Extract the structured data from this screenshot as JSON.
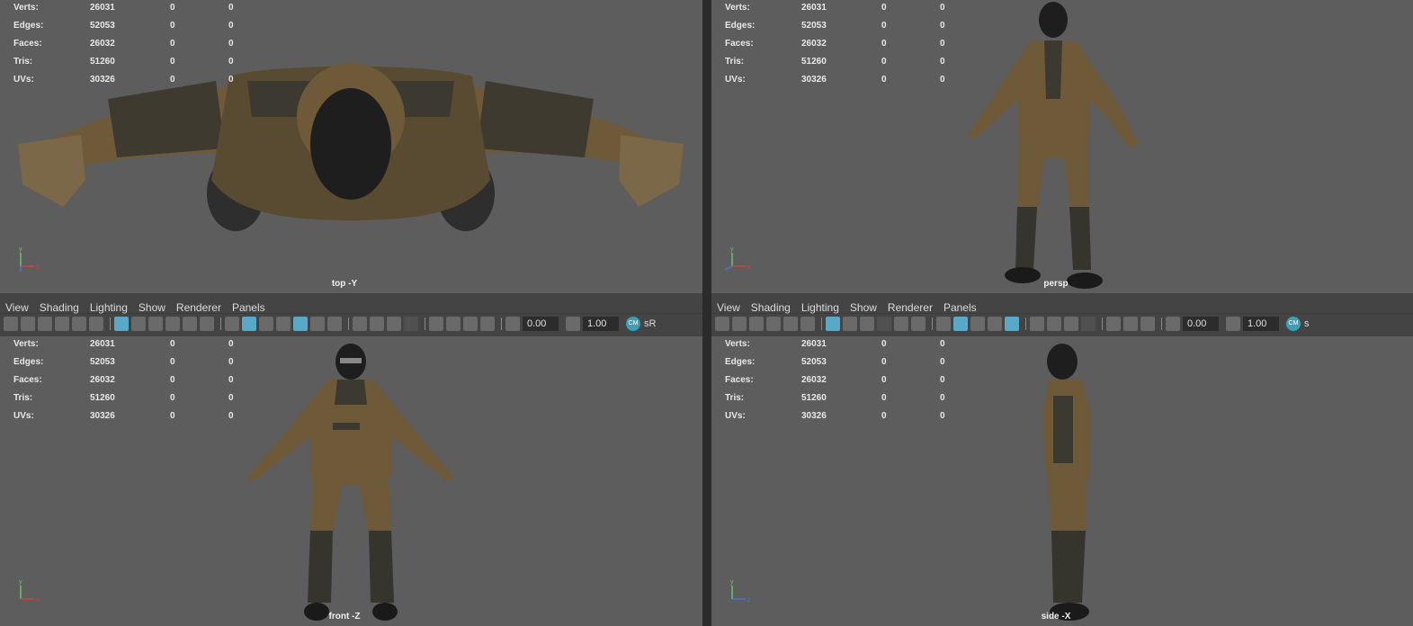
{
  "stats": {
    "labels": [
      "Verts:",
      "Edges:",
      "Faces:",
      "Tris:",
      "UVs:"
    ],
    "values": [
      [
        "26031",
        "0",
        "0"
      ],
      [
        "52053",
        "0",
        "0"
      ],
      [
        "26032",
        "0",
        "0"
      ],
      [
        "51260",
        "0",
        "0"
      ],
      [
        "30326",
        "0",
        "0"
      ]
    ]
  },
  "viewports": {
    "top": {
      "camera": "top -Y"
    },
    "persp": {
      "camera": "persp"
    },
    "front": {
      "camera": "front -Z"
    },
    "side": {
      "camera": "side -X"
    }
  },
  "axes": {
    "x": "x",
    "y": "y",
    "z": "z"
  },
  "menu": [
    "View",
    "Shading",
    "Lighting",
    "Show",
    "Renderer",
    "Panels"
  ],
  "toolbar": {
    "exposure": "0.00",
    "gamma": "1.00",
    "cm_label": "CM",
    "colorspace_left": "sR",
    "colorspace_right": "s"
  },
  "colors": {
    "viewport_bg": "#5d5d5d",
    "panel_bg": "#444444",
    "highlight": "#5aa8c8",
    "suit": "#6e5a38",
    "suit_dark": "#35342d",
    "mask": "#1e1e1e"
  }
}
